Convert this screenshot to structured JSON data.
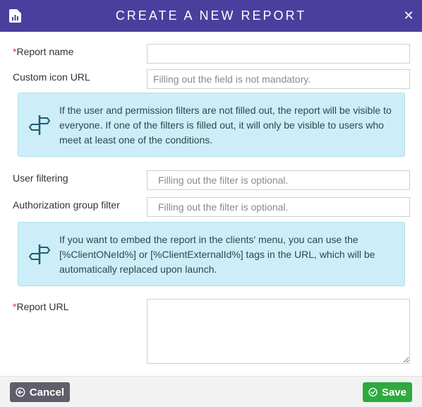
{
  "dialog": {
    "title": "CREATE A NEW REPORT",
    "header_color": "#4b3f9e",
    "icons": {
      "title": "report-chart-icon",
      "close": "close-icon"
    },
    "close_glyph": "✕"
  },
  "form": {
    "report_name": {
      "label": "Report name",
      "required_mark": "*",
      "value": ""
    },
    "custom_icon_url": {
      "label": "Custom icon URL",
      "placeholder": "Filling out the field is not mandatory."
    },
    "info_filters": {
      "icon": "signpost-icon",
      "text": "If the user and permission filters are not filled out, the report will be visible to everyone. If one of the filters is filled out, it will only be visible to users who meet at least one of the conditions."
    },
    "user_filtering": {
      "label": "User filtering",
      "placeholder": "Filling out the filter is optional."
    },
    "authorization_group_filter": {
      "label": "Authorization group filter",
      "placeholder": "Filling out the filter is optional."
    },
    "info_embed": {
      "icon": "signpost-icon",
      "text": "If you want to embed the report in the clients' menu, you can use the [%ClientONeId%] or [%ClientExternalId%] tags in the URL, which will be automatically replaced upon launch."
    },
    "report_url": {
      "label": "Report URL",
      "required_mark": "*",
      "value": ""
    }
  },
  "footer": {
    "cancel_label": "Cancel",
    "save_label": "Save",
    "icons": {
      "cancel": "arrow-left-circle-icon",
      "save": "check-circle-icon"
    },
    "colors": {
      "cancel": "#5f5f6b",
      "save": "#2eaa3f",
      "required": "#d9363e",
      "info_bg": "#cdeef8"
    }
  }
}
